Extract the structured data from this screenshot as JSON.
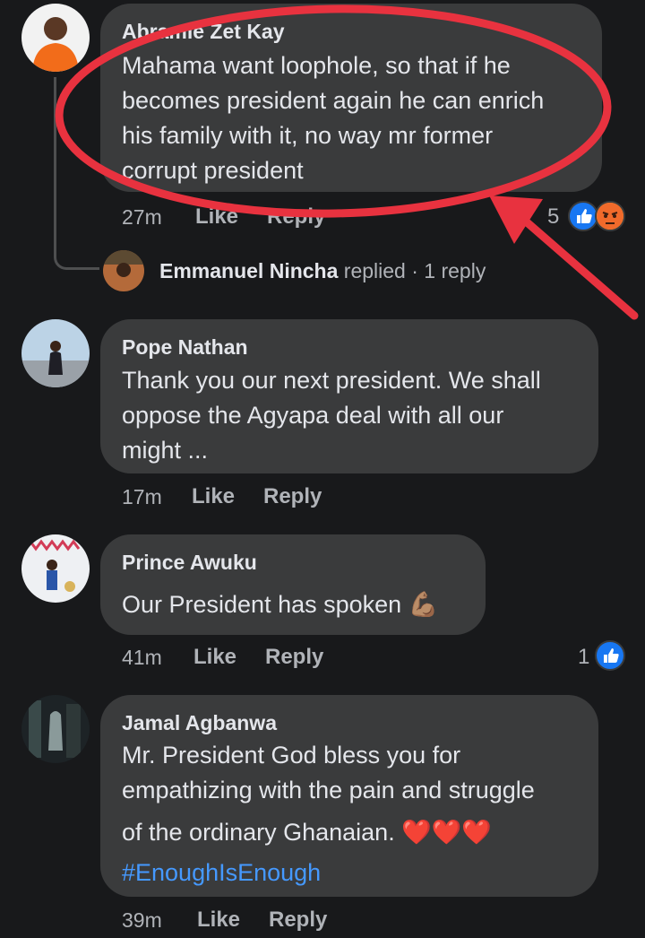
{
  "comments": [
    {
      "author": "Abramie Zet Kay",
      "lines": [
        "Mahama want loophole, so that if he",
        "becomes president again he can enrich",
        "his family with it, no way mr former",
        "corrupt president"
      ],
      "time": "27m",
      "like": "Like",
      "reply": "Reply",
      "reaction_count": "5",
      "reactions": [
        "like-icon",
        "angry-icon"
      ]
    },
    {
      "author": "Pope Nathan",
      "lines": [
        "Thank you our next president. We shall",
        "oppose the Agyapa deal with all our",
        "might ..."
      ],
      "time": "17m",
      "like": "Like",
      "reply": "Reply"
    },
    {
      "author": "Prince Awuku",
      "lines": [
        "Our President has spoken 💪🏽"
      ],
      "time": "41m",
      "like": "Like",
      "reply": "Reply",
      "reaction_count": "1",
      "reactions": [
        "like-icon"
      ]
    },
    {
      "author": "Jamal Agbanwa",
      "lines": [
        "Mr. President God bless you for",
        "empathizing with the pain and struggle",
        "of the ordinary Ghanaian. ❤️❤️❤️"
      ],
      "hashtag": "#EnoughIsEnough",
      "time": "39m",
      "like": "Like",
      "reply": "Reply"
    }
  ],
  "reply_summary": {
    "name": "Emmanuel Nincha",
    "action": "replied",
    "sep": "·",
    "count": "1 reply"
  },
  "annotation": {
    "circle_color": "#e8323f",
    "arrow_color": "#e8323f"
  },
  "colors": {
    "background": "#18191b",
    "bubble": "#3a3b3c",
    "text": "#e4e6eb",
    "muted": "#b0b3b8",
    "link": "#4599ff",
    "like_blue": "#1877f2"
  }
}
